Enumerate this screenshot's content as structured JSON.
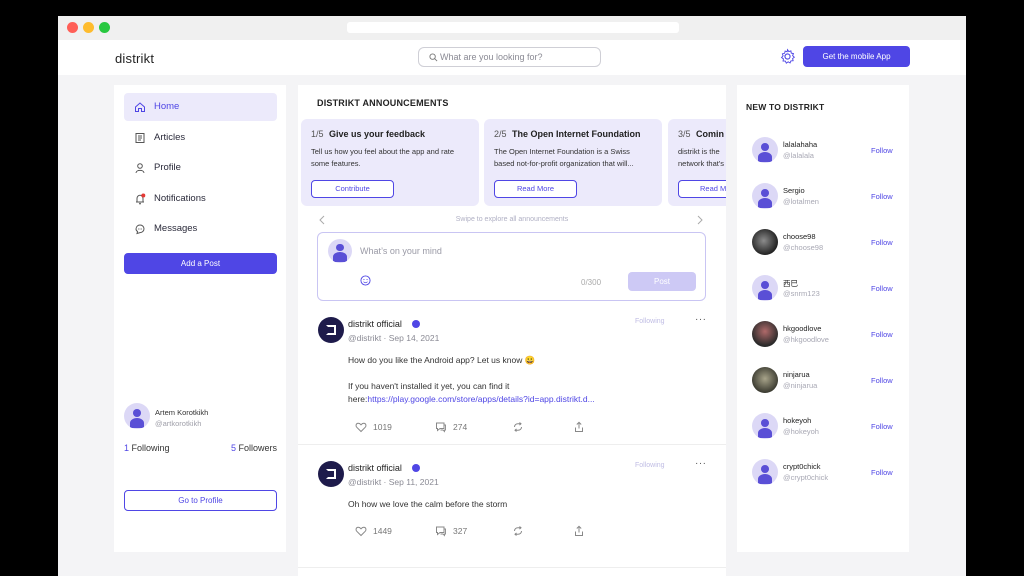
{
  "app": {
    "logo": "distrikt"
  },
  "header": {
    "search_placeholder": "What are you looking for?",
    "cta_label": "Get the mobile App"
  },
  "colors": {
    "accent": "#4f46e5",
    "accent_light": "#eceafb"
  },
  "sidebar": {
    "items": [
      {
        "label": "Home",
        "icon": "home-icon",
        "active": true
      },
      {
        "label": "Articles",
        "icon": "articles-icon",
        "active": false
      },
      {
        "label": "Profile",
        "icon": "profile-icon",
        "active": false
      },
      {
        "label": "Notifications",
        "icon": "bell-icon",
        "active": false
      },
      {
        "label": "Messages",
        "icon": "chat-icon",
        "active": false
      }
    ],
    "add_post_label": "Add a Post",
    "user": {
      "name": "Artem Korotkikh",
      "handle": "@artkorotkikh",
      "following_count": "1",
      "following_label": "Following",
      "followers_count": "5",
      "followers_label": "Followers"
    },
    "go_profile_label": "Go to Profile"
  },
  "announcements": {
    "title": "DISTRIKT ANNOUNCEMENTS",
    "cards": [
      {
        "index": "1/5",
        "title": "Give us your feedback",
        "text": "Tell us how you feel about the app and rate some features.",
        "button": "Contribute"
      },
      {
        "index": "2/5",
        "title": "The Open Internet Foundation",
        "text": "The Open Internet Foundation is a Swiss based not-for-profit organization that will...",
        "button": "Read More"
      },
      {
        "index": "3/5",
        "title": "Comin",
        "text": "distrikt is the network that's",
        "button": "Read M"
      }
    ],
    "swipe_hint": "Swipe to explore all announcements"
  },
  "composer": {
    "placeholder": "What’s on your mind",
    "counter": "0/300",
    "post_label": "Post"
  },
  "posts": [
    {
      "author": "distrikt official",
      "handle": "@distrikt",
      "date": "Sep 14, 2021",
      "follow_state": "Following",
      "more": "···",
      "line1": "How do you like the Android app? Let us know 😀",
      "line2": "If you haven't installed it yet, you can find it",
      "line3_prefix": "here:",
      "link": "https://play.google.com/store/apps/details?id=app.distrikt.d...",
      "likes": "1019",
      "comments": "274"
    },
    {
      "author": "distrikt official",
      "handle": "@distrikt",
      "date": "Sep 11, 2021",
      "follow_state": "Following",
      "more": "···",
      "line1": "Oh how we love the calm before the storm",
      "likes": "1449",
      "comments": "327"
    }
  ],
  "new_to_distrikt": {
    "title": "NEW TO DISTRIKT",
    "follow_label": "Follow",
    "users": [
      {
        "name": "lalalahaha",
        "handle": "@lalalala",
        "avatar": "default-avatar"
      },
      {
        "name": "Sergio",
        "handle": "@lotalmen",
        "avatar": "default-avatar"
      },
      {
        "name": "choose98",
        "handle": "@choose98",
        "avatar": "photo-avatar"
      },
      {
        "name": "西巳",
        "handle": "@snrm123",
        "avatar": "default-avatar"
      },
      {
        "name": "hkgoodlove",
        "handle": "@hkgoodlove",
        "avatar": "photo-avatar"
      },
      {
        "name": "ninjarua",
        "handle": "@ninjarua",
        "avatar": "photo-avatar"
      },
      {
        "name": "hokeyoh",
        "handle": "@hokeyoh",
        "avatar": "default-avatar"
      },
      {
        "name": "crypt0chick",
        "handle": "@crypt0chick",
        "avatar": "default-avatar"
      }
    ]
  }
}
